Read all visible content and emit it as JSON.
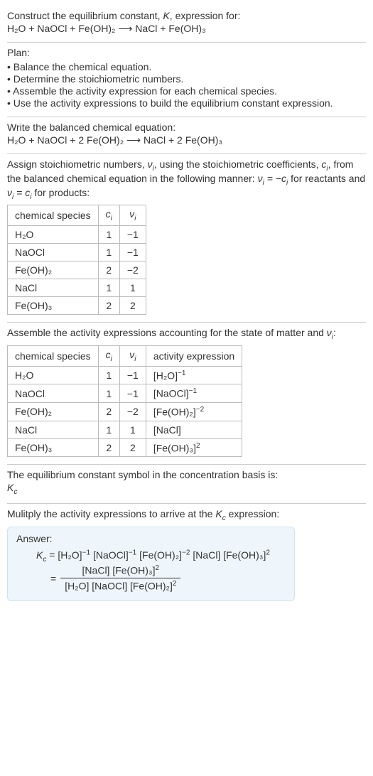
{
  "intro": {
    "line1_a": "Construct the equilibrium constant, ",
    "line1_b": ", expression for:",
    "equation": "H₂O + NaOCl + Fe(OH)₂  ⟶  NaCl + Fe(OH)₃"
  },
  "plan": {
    "heading": "Plan:",
    "items": [
      "• Balance the chemical equation.",
      "• Determine the stoichiometric numbers.",
      "• Assemble the activity expression for each chemical species.",
      "• Use the activity expressions to build the equilibrium constant expression."
    ]
  },
  "balanced": {
    "heading": "Write the balanced chemical equation:",
    "equation": "H₂O + NaOCl + 2 Fe(OH)₂  ⟶  NaCl + 2 Fe(OH)₃"
  },
  "stoich": {
    "text_a": "Assign stoichiometric numbers, ",
    "text_b": ", using the stoichiometric coefficients, ",
    "text_c": ", from the balanced chemical equation in the following manner: ",
    "text_d": " for reactants and ",
    "text_e": " for products:",
    "headers": {
      "species": "chemical species",
      "c": "cᵢ",
      "v": "νᵢ"
    },
    "rows": [
      {
        "species": "H₂O",
        "c": "1",
        "v": "−1"
      },
      {
        "species": "NaOCl",
        "c": "1",
        "v": "−1"
      },
      {
        "species": "Fe(OH)₂",
        "c": "2",
        "v": "−2"
      },
      {
        "species": "NaCl",
        "c": "1",
        "v": "1"
      },
      {
        "species": "Fe(OH)₃",
        "c": "2",
        "v": "2"
      }
    ]
  },
  "activity": {
    "text_a": "Assemble the activity expressions accounting for the state of matter and ",
    "text_b": ":",
    "headers": {
      "species": "chemical species",
      "c": "cᵢ",
      "v": "νᵢ",
      "expr": "activity expression"
    },
    "rows": [
      {
        "species": "H₂O",
        "c": "1",
        "v": "−1",
        "base": "[H₂O]",
        "exp": "−1"
      },
      {
        "species": "NaOCl",
        "c": "1",
        "v": "−1",
        "base": "[NaOCl]",
        "exp": "−1"
      },
      {
        "species": "Fe(OH)₂",
        "c": "2",
        "v": "−2",
        "base": "[Fe(OH)₂]",
        "exp": "−2"
      },
      {
        "species": "NaCl",
        "c": "1",
        "v": "1",
        "base": "[NaCl]",
        "exp": ""
      },
      {
        "species": "Fe(OH)₃",
        "c": "2",
        "v": "2",
        "base": "[Fe(OH)₃]",
        "exp": "2"
      }
    ]
  },
  "symbol": {
    "line": "The equilibrium constant symbol in the concentration basis is:",
    "kc_base": "K",
    "kc_sub": "c"
  },
  "multiply": {
    "text_a": "Mulitply the activity expressions to arrive at the ",
    "text_b": " expression:"
  },
  "answer": {
    "label": "Answer:",
    "eq": " = ",
    "terms": [
      {
        "base": "[H₂O]",
        "exp": "−1"
      },
      {
        "base": "[NaOCl]",
        "exp": "−1"
      },
      {
        "base": "[Fe(OH)₂]",
        "exp": "−2"
      },
      {
        "base": "[NaCl]",
        "exp": ""
      },
      {
        "base": "[Fe(OH)₃]",
        "exp": "2"
      }
    ],
    "num": [
      {
        "base": "[NaCl]",
        "exp": ""
      },
      {
        "base": "[Fe(OH)₃]",
        "exp": "2"
      }
    ],
    "den": [
      {
        "base": "[H₂O]",
        "exp": ""
      },
      {
        "base": "[NaOCl]",
        "exp": ""
      },
      {
        "base": "[Fe(OH)₂]",
        "exp": "2"
      }
    ]
  }
}
